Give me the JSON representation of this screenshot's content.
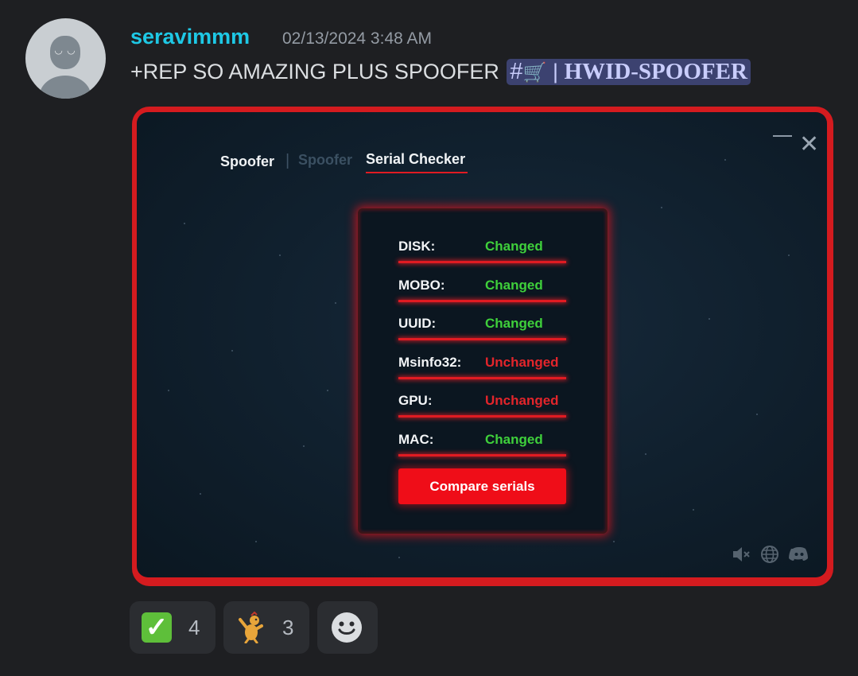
{
  "message": {
    "username": "seravimmm",
    "timestamp": "02/13/2024 3:48 AM",
    "text": "+REP SO AMAZING PLUS SPOOFER",
    "channel_mention": {
      "hash": "#",
      "emoji": "🛒",
      "separator": "|",
      "name": "HWID-SPOOFER"
    }
  },
  "spoofer_app": {
    "tabs": [
      {
        "label": "Spoofer"
      },
      {
        "label": "|"
      },
      {
        "label": "Spoofer"
      },
      {
        "label": "Serial Checker"
      }
    ],
    "rows": [
      {
        "label": "DISK:",
        "status": "Changed"
      },
      {
        "label": "MOBO:",
        "status": "Changed"
      },
      {
        "label": "UUID:",
        "status": "Changed"
      },
      {
        "label": "Msinfo32:",
        "status": "Unchanged"
      },
      {
        "label": "GPU:",
        "status": "Unchanged"
      },
      {
        "label": "MAC:",
        "status": "Changed"
      }
    ],
    "compare_button": "Compare serials",
    "footer_icons": [
      "mute-icon",
      "globe-icon",
      "discord-icon"
    ]
  },
  "reactions": [
    {
      "emoji": "check-mark-emoji",
      "count": "4"
    },
    {
      "emoji": "dancing-figure-emoji",
      "count": "3"
    },
    {
      "emoji": "add-reaction-icon"
    }
  ],
  "colors": {
    "username": "#1ec8e5",
    "accent_red": "#e01b22",
    "changed": "#3fd03b",
    "unchanged": "#e3252b",
    "background": "#1e1f22"
  }
}
